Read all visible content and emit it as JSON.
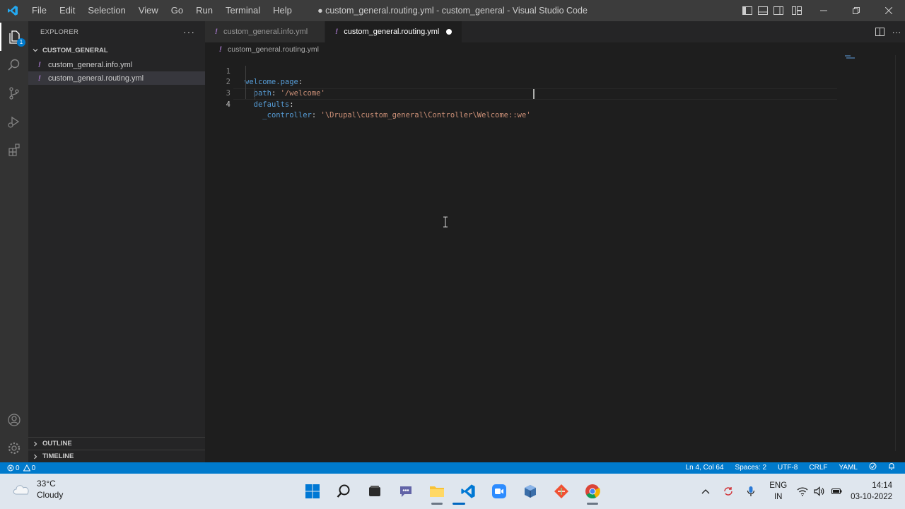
{
  "titlebar": {
    "menu": [
      "File",
      "Edit",
      "Selection",
      "View",
      "Go",
      "Run",
      "Terminal",
      "Help"
    ],
    "window_title": "● custom_general.routing.yml - custom_general - Visual Studio Code"
  },
  "activity_bar": {
    "icons": [
      "explorer-icon",
      "search-icon",
      "source-control-icon",
      "run-debug-icon",
      "extensions-icon",
      "account-icon",
      "settings-gear-icon"
    ],
    "explorer_badge": "1"
  },
  "sidebar": {
    "header": "EXPLORER",
    "folder": "CUSTOM_GENERAL",
    "files": [
      {
        "icon": "!",
        "name": "custom_general.info.yml"
      },
      {
        "icon": "!",
        "name": "custom_general.routing.yml"
      }
    ],
    "sections": [
      "OUTLINE",
      "TIMELINE"
    ]
  },
  "editor": {
    "tabs": [
      {
        "icon": "!",
        "label": "custom_general.info.yml"
      },
      {
        "icon": "!",
        "label": "custom_general.routing.yml"
      }
    ],
    "breadcrumb": {
      "icon": "!",
      "label": "custom_general.routing.yml"
    },
    "lines": [
      {
        "num": "1",
        "indent": "",
        "key": "welcome.page",
        "sep": ":",
        "value": ""
      },
      {
        "num": "2",
        "indent": "  ",
        "key": "path",
        "sep": ": ",
        "value": "'/welcome'"
      },
      {
        "num": "3",
        "indent": "  ",
        "key": "defaults",
        "sep": ":",
        "value": ""
      },
      {
        "num": "4",
        "indent": "    ",
        "key": "_controller",
        "sep": ": ",
        "value": "'\\Drupal\\custom_general\\Controller\\Welcome::we'"
      }
    ]
  },
  "statusbar": {
    "errors": "0",
    "warnings": "0",
    "position": "Ln 4, Col 64",
    "spaces": "Spaces: 2",
    "encoding": "UTF-8",
    "eol": "CRLF",
    "language": "YAML"
  },
  "taskbar": {
    "weather_temp": "33°C",
    "weather_desc": "Cloudy",
    "lang_top": "ENG",
    "lang_bottom": "IN",
    "time": "14:14",
    "date": "03-10-2022"
  },
  "colors": {
    "accent": "#007acc",
    "titlebar": "#3c3c3c",
    "activitybar": "#333333",
    "sidebar": "#252526",
    "editor": "#1e1e1e",
    "yaml_key": "#569cd6",
    "yaml_string": "#ce9178",
    "yaml_icon": "#a074c4"
  }
}
